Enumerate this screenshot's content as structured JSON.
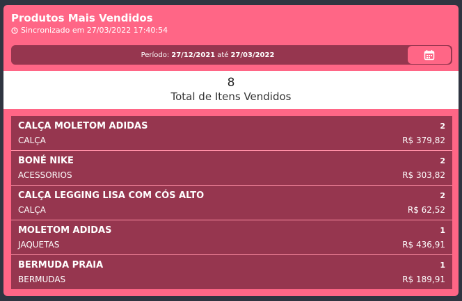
{
  "header": {
    "title": "Produtos Mais Vendidos",
    "sync_text": "Sincronizado em 27/03/2022 17:40:54"
  },
  "period": {
    "label": "Período:",
    "start": "27/12/2021",
    "separator": "até",
    "end": "27/03/2022",
    "calendar_icon": "calendar-icon"
  },
  "summary": {
    "count": "8",
    "label": "Total de Itens Vendidos"
  },
  "products": [
    {
      "name": "CALÇA MOLETOM ADIDAS",
      "category": "CALÇA",
      "quantity": "2",
      "price": "R$ 379,82"
    },
    {
      "name": "BONÉ NIKE",
      "category": "ACESSORIOS",
      "quantity": "2",
      "price": "R$ 303,82"
    },
    {
      "name": "CALÇA LEGGING LISA COM CÓS ALTO",
      "category": "CALÇA",
      "quantity": "2",
      "price": "R$ 62,52"
    },
    {
      "name": "MOLETOM ADIDAS",
      "category": "JAQUETAS",
      "quantity": "1",
      "price": "R$ 436,91"
    },
    {
      "name": "BERMUDA PRAIA",
      "category": "BERMUDAS",
      "quantity": "1",
      "price": "R$ 189,91"
    }
  ],
  "colors": {
    "accent": "#ff6686",
    "dark_accent": "#96364f",
    "background": "#2f3541"
  }
}
